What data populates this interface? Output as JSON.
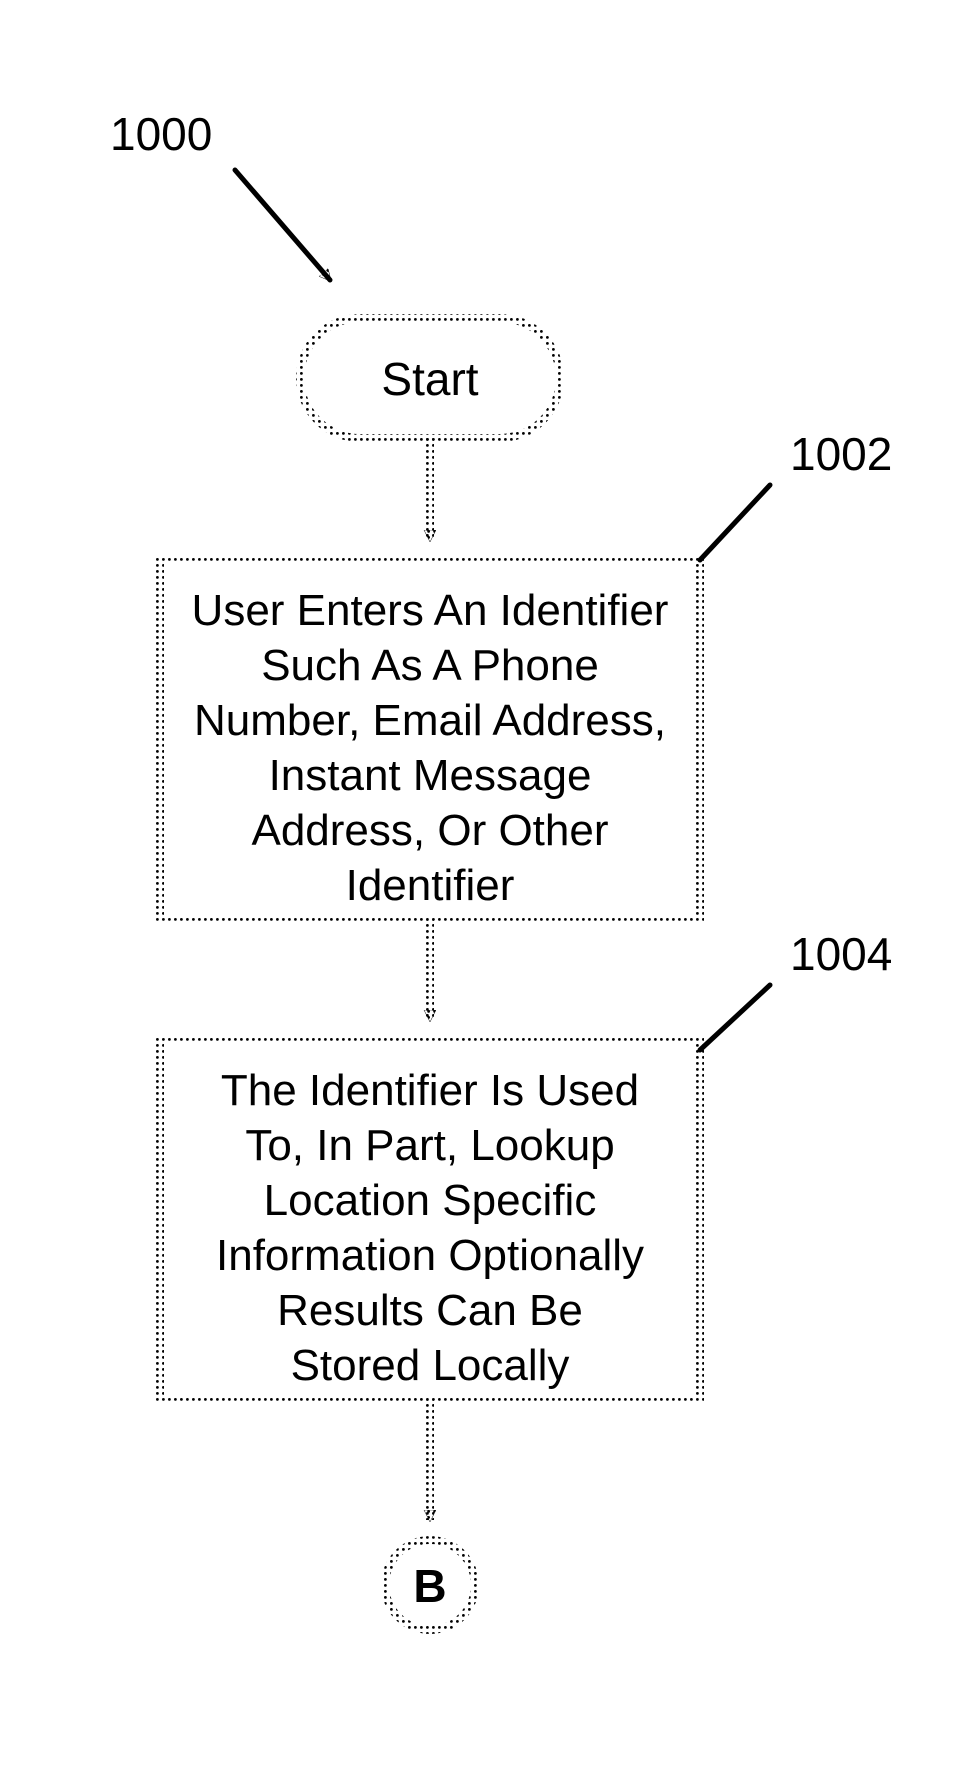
{
  "labels": {
    "ref_1000": "1000",
    "ref_1002": "1002",
    "ref_1004": "1004"
  },
  "nodes": {
    "start": "Start",
    "step_1002": {
      "l1": "User Enters An Identifier",
      "l2": "Such As A Phone",
      "l3": "Number, Email Address,",
      "l4": "Instant Message",
      "l5": "Address, Or Other",
      "l6": "Identifier"
    },
    "step_1004": {
      "l1": "The Identifier Is Used",
      "l2": "To, In Part, Lookup",
      "l3": "Location Specific",
      "l4": "Information Optionally",
      "l5": "Results Can Be",
      "l6": "Stored Locally"
    },
    "connector_b": "B"
  },
  "style": {
    "stroke": "#000000",
    "stroke_width": 4,
    "dashed": "10 10"
  }
}
